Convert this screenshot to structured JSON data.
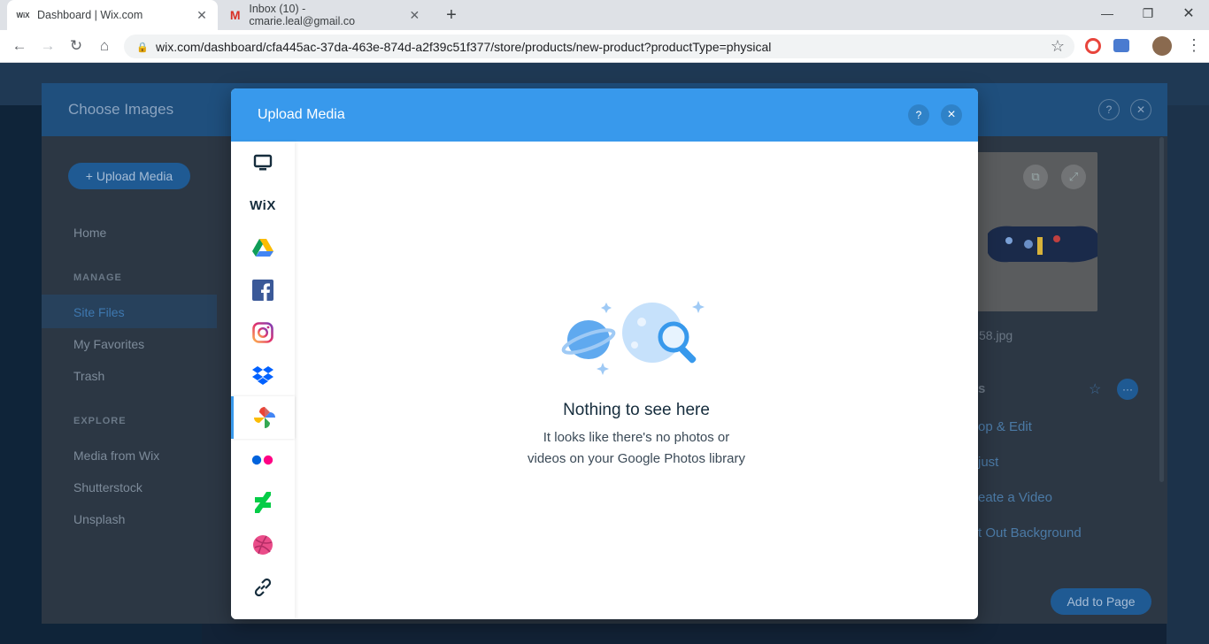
{
  "browser": {
    "tabs": [
      {
        "title": "Dashboard | Wix.com",
        "favicon": "WiX"
      },
      {
        "title": "Inbox (10) - cmarie.leal@gmail.co",
        "favicon": "M"
      }
    ],
    "url": "wix.com/dashboard/cfa445ac-37da-463e-874d-a2f39c51f377/store/products/new-product?productType=physical"
  },
  "choose_images": {
    "title": "Choose Images",
    "upload_label": "+ Upload Media",
    "nav": {
      "home": "Home",
      "manage_heading": "MANAGE",
      "site_files": "Site Files",
      "favorites": "My Favorites",
      "trash": "Trash",
      "explore_heading": "EXPLORE",
      "media_from_wix": "Media from Wix",
      "shutterstock": "Shutterstock",
      "unsplash": "Unsplash"
    },
    "file_name": "58.jpg",
    "details_label": "s",
    "actions": [
      "op & Edit",
      "just",
      "eate a Video",
      "t Out Background"
    ],
    "add_to_page": "Add to Page"
  },
  "upload_media": {
    "title": "Upload Media",
    "help": "?",
    "close": "×",
    "sources": [
      "computer-icon",
      "wix-icon",
      "google-drive-icon",
      "facebook-icon",
      "instagram-icon",
      "dropbox-icon",
      "google-photos-icon",
      "flickr-icon",
      "deviantart-icon",
      "dribbble-icon",
      "link-icon"
    ],
    "active_source": "google-photos-icon",
    "wix_label": "WiX",
    "empty_title": "Nothing to see here",
    "empty_line1": "It looks like there's no photos or",
    "empty_line2": "videos on your Google Photos library"
  },
  "colors": {
    "accent": "#3899ec",
    "header_dim": "#1f4f7d"
  }
}
